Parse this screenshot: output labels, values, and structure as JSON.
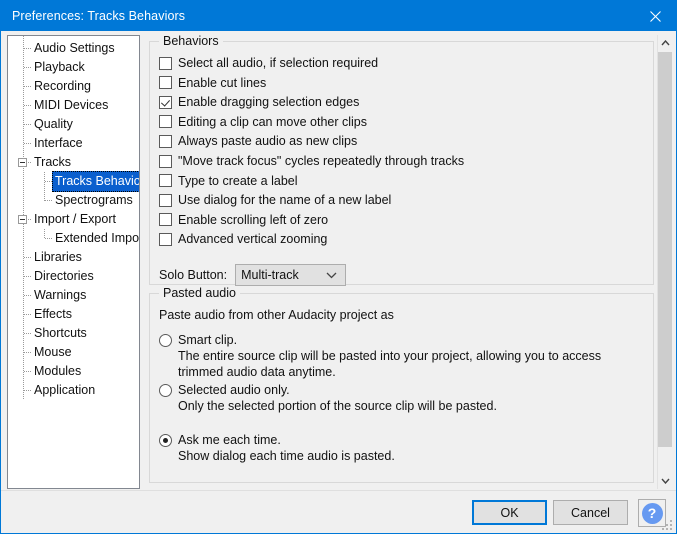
{
  "window": {
    "title": "Preferences: Tracks Behaviors",
    "close_icon": "close-x-icon",
    "accent_color": "#0078d7"
  },
  "sidebar": {
    "items": [
      {
        "label": "Audio Settings",
        "level": 1,
        "expander": false,
        "selected": false
      },
      {
        "label": "Playback",
        "level": 1,
        "expander": false,
        "selected": false
      },
      {
        "label": "Recording",
        "level": 1,
        "expander": false,
        "selected": false
      },
      {
        "label": "MIDI Devices",
        "level": 1,
        "expander": false,
        "selected": false
      },
      {
        "label": "Quality",
        "level": 1,
        "expander": false,
        "selected": false
      },
      {
        "label": "Interface",
        "level": 1,
        "expander": false,
        "selected": false
      },
      {
        "label": "Tracks",
        "level": 1,
        "expander": true,
        "selected": false
      },
      {
        "label": "Tracks Behaviors",
        "level": 2,
        "expander": false,
        "selected": true
      },
      {
        "label": "Spectrograms",
        "level": 2,
        "expander": false,
        "selected": false
      },
      {
        "label": "Import / Export",
        "level": 1,
        "expander": true,
        "selected": false
      },
      {
        "label": "Extended Import",
        "level": 2,
        "expander": false,
        "selected": false
      },
      {
        "label": "Libraries",
        "level": 1,
        "expander": false,
        "selected": false
      },
      {
        "label": "Directories",
        "level": 1,
        "expander": false,
        "selected": false
      },
      {
        "label": "Warnings",
        "level": 1,
        "expander": false,
        "selected": false
      },
      {
        "label": "Effects",
        "level": 1,
        "expander": false,
        "selected": false
      },
      {
        "label": "Shortcuts",
        "level": 1,
        "expander": false,
        "selected": false
      },
      {
        "label": "Mouse",
        "level": 1,
        "expander": false,
        "selected": false
      },
      {
        "label": "Modules",
        "level": 1,
        "expander": false,
        "selected": false
      },
      {
        "label": "Application",
        "level": 1,
        "expander": false,
        "selected": false
      }
    ]
  },
  "behaviors": {
    "group_title": "Behaviors",
    "checkboxes": [
      {
        "label": "Select all audio, if selection required",
        "checked": false
      },
      {
        "label": "Enable cut lines",
        "checked": false
      },
      {
        "label": "Enable dragging selection edges",
        "checked": true
      },
      {
        "label": "Editing a clip can move other clips",
        "checked": false
      },
      {
        "label": "Always paste audio as new clips",
        "checked": false
      },
      {
        "label": "\"Move track focus\" cycles repeatedly through tracks",
        "checked": false
      },
      {
        "label": "Type to create a label",
        "checked": false
      },
      {
        "label": "Use dialog for the name of a new label",
        "checked": false
      },
      {
        "label": "Enable scrolling left of zero",
        "checked": false
      },
      {
        "label": "Advanced vertical zooming",
        "checked": false
      }
    ],
    "solo": {
      "label": "Solo Button:",
      "value": "Multi-track",
      "arrow_icon": "chevron-down-icon"
    }
  },
  "pasted_audio": {
    "group_title": "Pasted audio",
    "intro": "Paste audio from other Audacity project as",
    "options": [
      {
        "label": "Smart clip.",
        "selected": false,
        "description_lines": [
          "The entire source clip will be pasted into your project, allowing you to access",
          "trimmed audio data anytime."
        ]
      },
      {
        "label": "Selected audio only.",
        "selected": false,
        "description_lines": [
          "Only the selected portion of the source clip will be pasted."
        ]
      },
      {
        "label": "Ask me each time.",
        "selected": true,
        "description_lines": [
          "Show dialog each time audio is pasted."
        ]
      }
    ]
  },
  "scrollbar": {
    "up_icon": "chevron-up-icon",
    "down_icon": "chevron-down-icon"
  },
  "buttons": {
    "ok": "OK",
    "cancel": "Cancel",
    "help": "?",
    "help_icon": "help-circle-icon"
  }
}
